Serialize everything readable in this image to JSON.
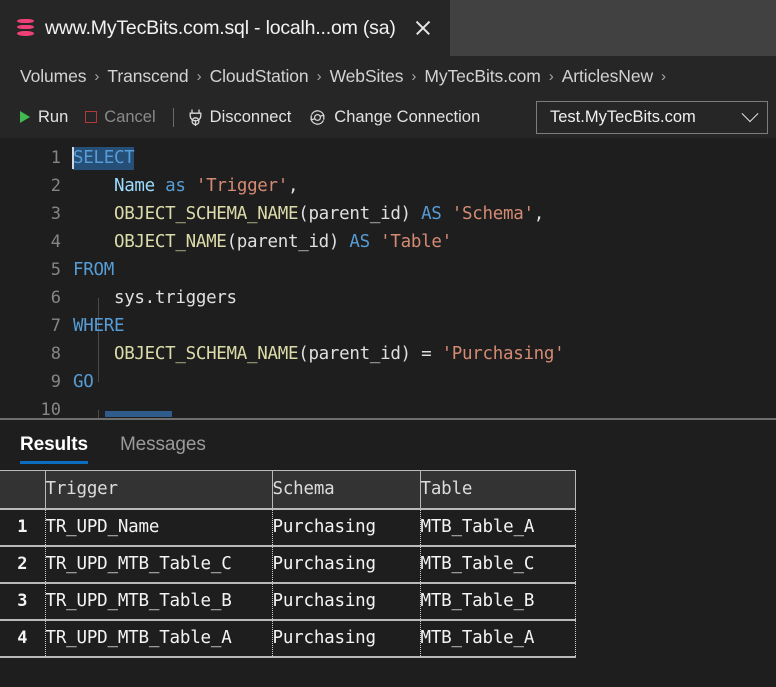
{
  "window": {
    "tab": {
      "icon": "database-icon",
      "title": "www.MyTecBits.com.sql - localh...om (sa)",
      "close_label": "×"
    }
  },
  "breadcrumb": {
    "separator": "›",
    "items": [
      "Volumes",
      "Transcend",
      "CloudStation",
      "WebSites",
      "MyTecBits.com",
      "ArticlesNew"
    ]
  },
  "toolbar": {
    "run_label": "Run",
    "cancel_label": "Cancel",
    "disconnect_label": "Disconnect",
    "change_connection_label": "Change Connection",
    "connection": {
      "value": "Test.MyTecBits.com",
      "options": [
        "Test.MyTecBits.com"
      ]
    }
  },
  "editor": {
    "line_numbers": [
      "1",
      "2",
      "3",
      "4",
      "5",
      "6",
      "7",
      "8",
      "9",
      "10"
    ],
    "lines": [
      {
        "n": "1",
        "text": "SELECT"
      },
      {
        "n": "2",
        "text": "    Name as 'Trigger',"
      },
      {
        "n": "3",
        "text": "    OBJECT_SCHEMA_NAME(parent_id) AS 'Schema',"
      },
      {
        "n": "4",
        "text": "    OBJECT_NAME(parent_id) AS 'Table'"
      },
      {
        "n": "5",
        "text": "FROM"
      },
      {
        "n": "6",
        "text": "    sys.triggers"
      },
      {
        "n": "7",
        "text": "WHERE"
      },
      {
        "n": "8",
        "text": "    OBJECT_SCHEMA_NAME(parent_id) = 'Purchasing'"
      },
      {
        "n": "9",
        "text": "GO"
      },
      {
        "n": "10",
        "text": ""
      }
    ],
    "tokens": {
      "t_select": "SELECT",
      "t_name": "Name",
      "t_as_lower": "as",
      "t_trigger_str": "'Trigger'",
      "t_comma": ",",
      "t_obj_schema_name": "OBJECT_SCHEMA_NAME",
      "t_paren_parent": "(parent_id)",
      "t_as_upper": "AS",
      "t_schema_str": "'Schema'",
      "t_obj_name": "OBJECT_NAME",
      "t_table_str": "'Table'",
      "t_from": "FROM",
      "t_sys_triggers": "sys.triggers",
      "t_where": "WHERE",
      "t_eq": "=",
      "t_purchasing_str": "'Purchasing'",
      "t_go": "GO"
    },
    "selection": "SELECT"
  },
  "results": {
    "tabs": [
      {
        "label": "Results",
        "active": true
      },
      {
        "label": "Messages",
        "active": false
      }
    ],
    "columns": [
      "",
      "Trigger",
      "Schema",
      "Table"
    ],
    "rows": [
      {
        "idx": "1",
        "trigger": "TR_UPD_Name",
        "schema": "Purchasing",
        "table": "MTB_Table_A"
      },
      {
        "idx": "2",
        "trigger": "TR_UPD_MTB_Table_C",
        "schema": "Purchasing",
        "table": "MTB_Table_C"
      },
      {
        "idx": "3",
        "trigger": "TR_UPD_MTB_Table_B",
        "schema": "Purchasing",
        "table": "MTB_Table_B"
      },
      {
        "idx": "4",
        "trigger": "TR_UPD_MTB_Table_A",
        "schema": "Purchasing",
        "table": "MTB_Table_A"
      }
    ]
  },
  "colors": {
    "accent_blue": "#0a6fc2",
    "keyword_blue": "#569cd6",
    "function_yellow": "#dcdcaa",
    "string_salmon": "#d48a73",
    "identifier_blue": "#9cdcfe",
    "selection_blue": "#264f78",
    "db_icon_pink": "#ef4078",
    "run_green": "#3fb950",
    "cancel_red": "#b03a3a",
    "editor_bg": "#1e1e1e",
    "chrome_bg": "#262626",
    "tabstrip_bg": "#414141"
  }
}
